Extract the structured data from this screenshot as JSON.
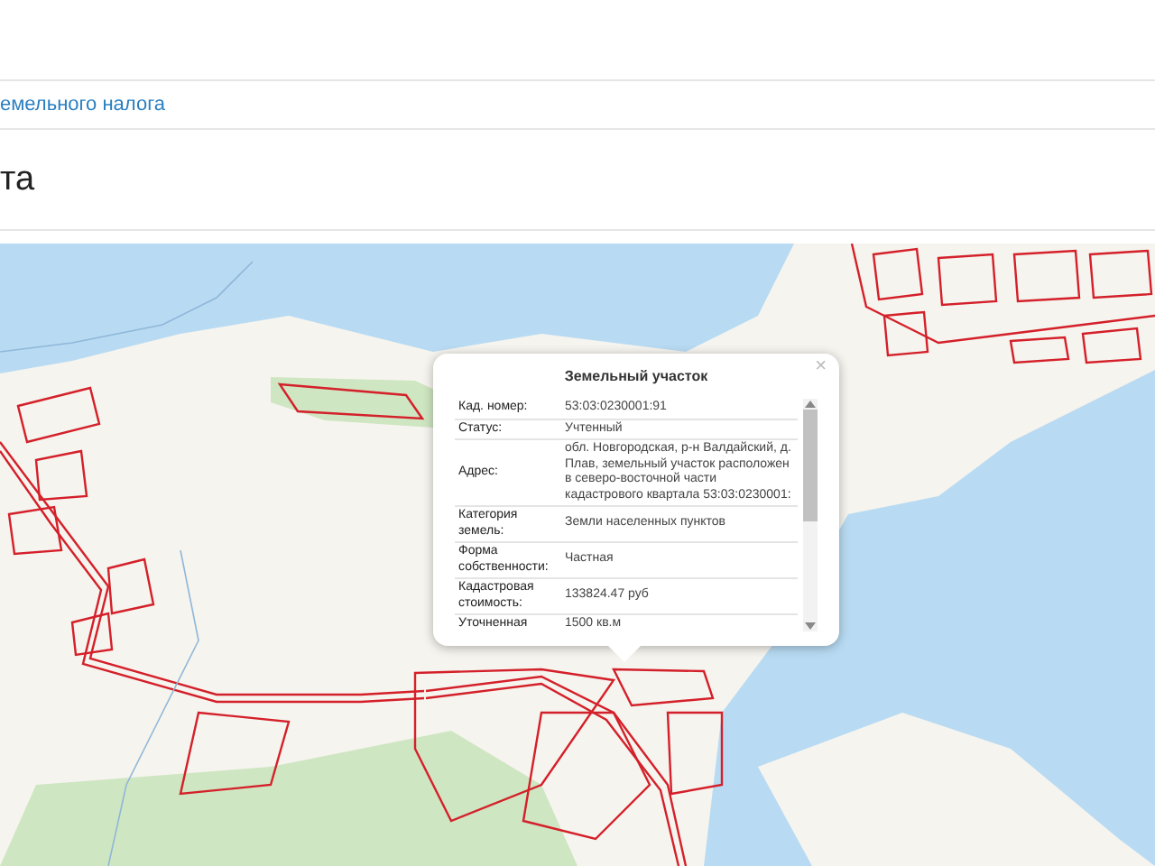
{
  "breadcrumb_link": "емельного налога",
  "heading": "та",
  "popup": {
    "title": "Земельный участок",
    "close": "×",
    "rows": [
      {
        "label": "Кад. номер:",
        "value": "53:03:0230001:91"
      },
      {
        "label": "Статус:",
        "value": "Учтенный"
      },
      {
        "label": "Адрес:",
        "value": "обл. Новгородская, р-н Валдайский, д. Плав, земельный участок расположен в северо-восточной части кадастрового квартала 53:03:0230001:"
      },
      {
        "label": "Категория земель:",
        "value": "Земли населенных пунктов"
      },
      {
        "label": "Форма собственности:",
        "value": "Частная"
      },
      {
        "label": "Кадастровая стоимость:",
        "value": "133824.47 руб"
      },
      {
        "label": "Уточненная",
        "value": "1500 кв.м"
      }
    ]
  }
}
